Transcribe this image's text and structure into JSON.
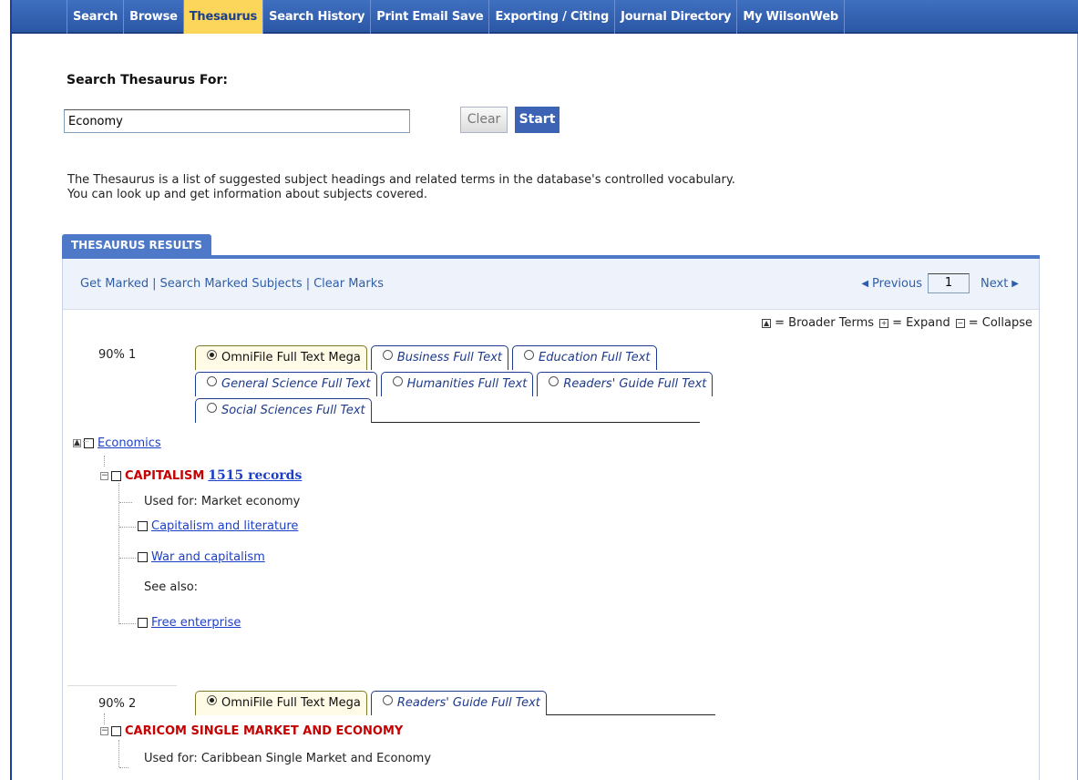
{
  "nav": {
    "tabs": [
      {
        "label": "Search"
      },
      {
        "label": "Browse"
      },
      {
        "label": "Thesaurus"
      },
      {
        "label": "Search History"
      },
      {
        "label": "Print Email Save"
      },
      {
        "label": "Exporting / Citing"
      },
      {
        "label": "Journal Directory"
      },
      {
        "label": "My WilsonWeb"
      }
    ],
    "active": "Thesaurus"
  },
  "search": {
    "label": "Search Thesaurus For:",
    "value": "Economy",
    "clear_label": "Clear",
    "start_label": "Start"
  },
  "description": {
    "line1": "The Thesaurus is a list of suggested subject headings and related terms in the database's controlled vocabulary.",
    "line2": "You can look up and get information about subjects covered."
  },
  "results": {
    "tab_label": "THESAURUS RESULTS",
    "actions": {
      "get_marked": "Get Marked",
      "search_marked": "Search Marked Subjects",
      "clear_marks": "Clear Marks",
      "separator": "|"
    },
    "pager": {
      "previous": "Previous",
      "page": "1",
      "next": "Next"
    },
    "legend": {
      "broader": "= Broader Terms",
      "expand": "= Expand",
      "collapse": "= Collapse"
    }
  },
  "result1": {
    "rank": "90% 1",
    "databases": {
      "omnifile": "OmniFile Full Text Mega",
      "business": "Business Full Text",
      "education": "Education Full Text",
      "general_science": "General Science Full Text",
      "humanities": "Humanities Full Text",
      "readers_guide": "Readers' Guide Full Text",
      "social_sciences": "Social Sciences Full Text"
    },
    "broader_term": "Economics",
    "term": "CAPITALISM",
    "records": "1515 records",
    "used_for": "Used for: Market economy",
    "narrower": [
      "Capitalism and literature",
      "War and capitalism"
    ],
    "see_also_label": "See also:",
    "see_also": [
      "Free enterprise"
    ]
  },
  "result2": {
    "rank": "90% 2",
    "databases": {
      "omnifile": "OmniFile Full Text Mega",
      "readers_guide": "Readers' Guide Full Text"
    },
    "term": "CARICOM SINGLE MARKET AND ECONOMY",
    "used_for": "Used for: Caribbean Single Market and Economy"
  }
}
